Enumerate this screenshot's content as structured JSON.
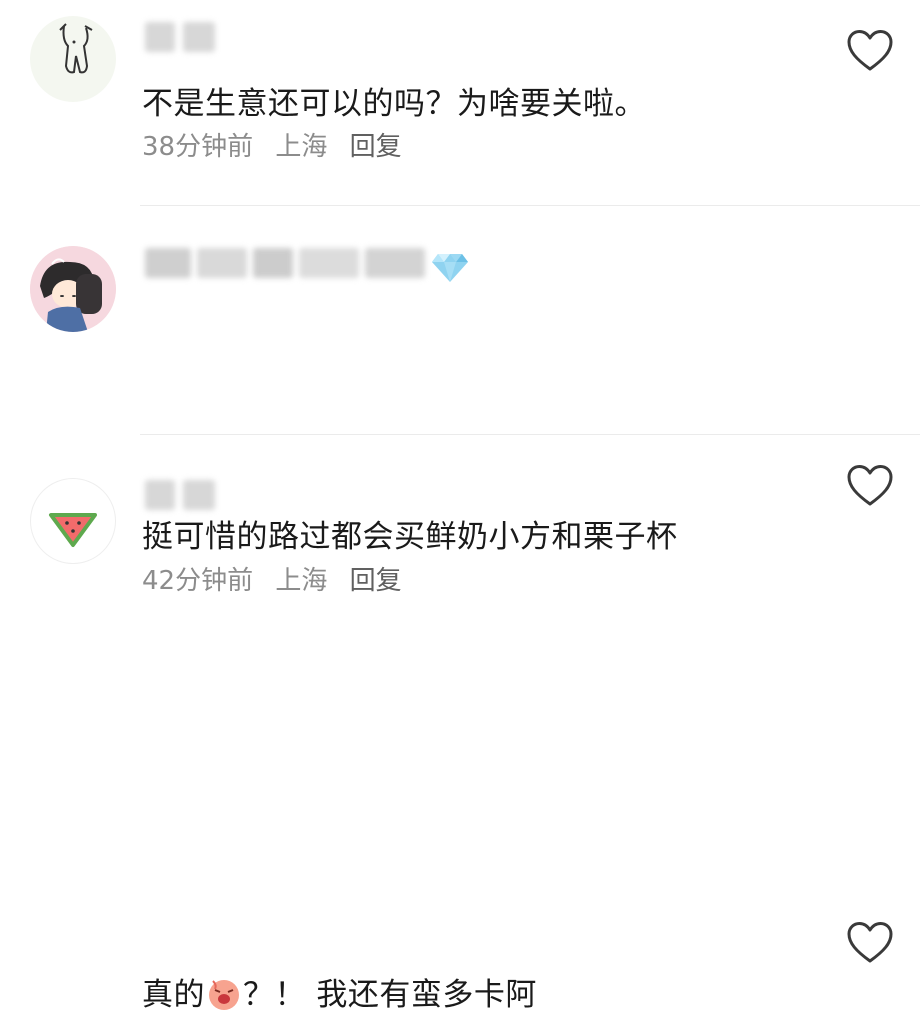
{
  "comments": [
    {
      "text": "不是生意还可以的吗？为啥要关啦。",
      "time": "38分钟前",
      "location": "上海",
      "reply_label": "回复",
      "avatar_icon": "bunny-sticker-icon",
      "like_icon": "heart-outline-icon"
    },
    {
      "text": "挺可惜的路过都会买鲜奶小方和栗子杯",
      "time": "42分钟前",
      "location": "上海",
      "reply_label": "回复",
      "avatar_icon": "anime-couple-avatar-icon",
      "badge_icon": "diamond-icon",
      "like_icon": "heart-outline-icon"
    },
    {
      "text_before": "真的",
      "text_after": "？！ 我还有蛮多卡阿",
      "emoji": "crying-face-emoji",
      "avatar_icon": "watermelon-icon",
      "like_icon": "heart-outline-icon"
    }
  ],
  "colors": {
    "text": "#1a1a1a",
    "meta": "#8c8c8c",
    "heart": "#3a3a3a",
    "diamond": "#8fd3f0"
  }
}
